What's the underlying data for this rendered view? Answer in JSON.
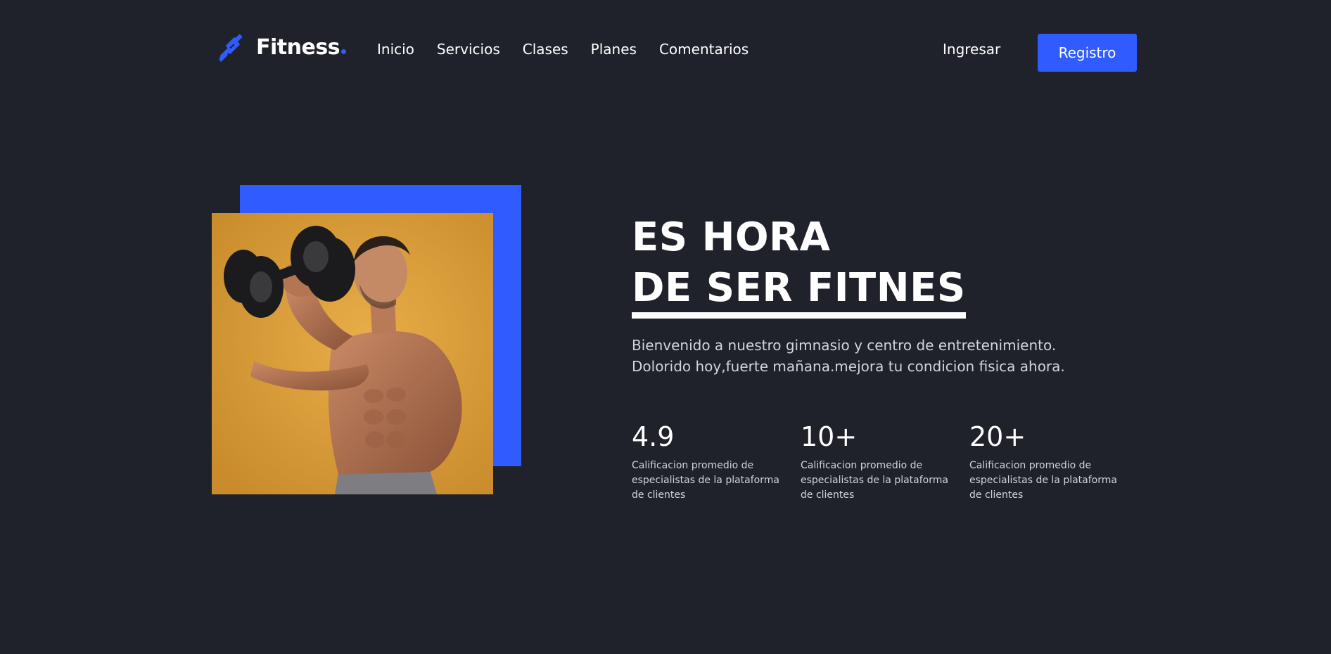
{
  "brand": {
    "logo_text": "Fitness",
    "logo_icon": "dumbbell-icon",
    "accent_color": "#2f5bff",
    "background_color": "#1f212b"
  },
  "nav": {
    "items": [
      {
        "label": "Inicio"
      },
      {
        "label": "Servicios"
      },
      {
        "label": "Clases"
      },
      {
        "label": "Planes"
      },
      {
        "label": "Comentarios"
      }
    ]
  },
  "auth": {
    "login_label": "Ingresar",
    "register_label": "Registro"
  },
  "hero": {
    "title_line1": "ES HORA",
    "title_line2": "DE SER FITNES",
    "description_line1": "Bienvenido a nuestro gimnasio y centro de entretenimiento.",
    "description_line2": "Dolorido hoy,fuerte mañana.mejora tu condicion fisica ahora.",
    "image": "man-lifting-dumbbell-photo",
    "image_background": "#e0a440"
  },
  "stats": [
    {
      "value": "4.9",
      "label": "Calificacion promedio de especialistas de la plataforma de clientes"
    },
    {
      "value": "10+",
      "label": "Calificacion promedio de especialistas de la plataforma de clientes"
    },
    {
      "value": "20+",
      "label": "Calificacion promedio de especialistas de la plataforma de clientes"
    }
  ]
}
